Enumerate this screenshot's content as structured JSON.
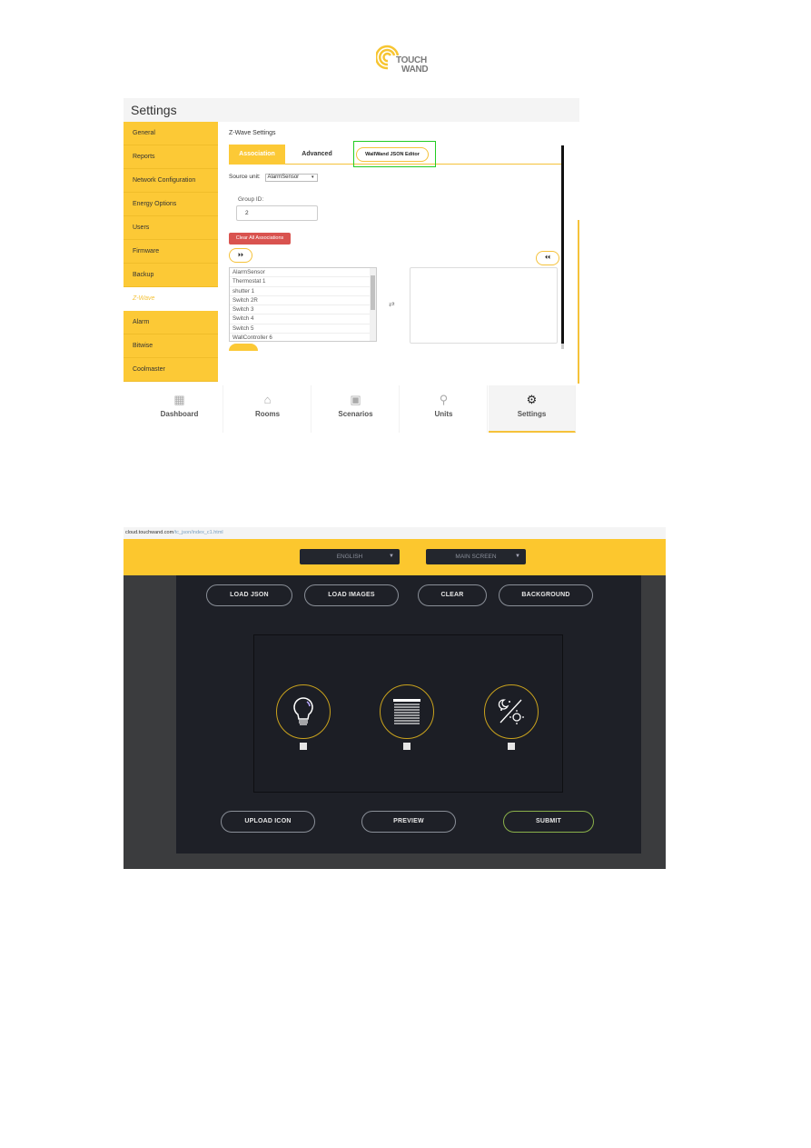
{
  "logo": {
    "line1": "TOUCH",
    "line2": "WAND"
  },
  "settings_screen": {
    "title": "Settings",
    "sidebar": [
      {
        "label": "General",
        "active": false
      },
      {
        "label": "Reports",
        "active": false
      },
      {
        "label": "Network Configuration",
        "active": false
      },
      {
        "label": "Energy Options",
        "active": false
      },
      {
        "label": "Users",
        "active": false
      },
      {
        "label": "Firmware",
        "active": false
      },
      {
        "label": "Backup",
        "active": false
      },
      {
        "label": "Z-Wave",
        "active": true
      },
      {
        "label": "Alarm",
        "active": false
      },
      {
        "label": "Bitwise",
        "active": false
      },
      {
        "label": "Coolmaster",
        "active": false
      }
    ],
    "zwave": {
      "section_title": "Z-Wave Settings",
      "tabs": [
        {
          "label": "Association",
          "active": true
        },
        {
          "label": "Advanced",
          "active": false
        },
        {
          "label": "WallWand JSON Editor",
          "active": false,
          "highlighted": true
        }
      ],
      "source_unit_label": "Source unit:",
      "source_unit_value": "AlarmSensor",
      "group_id_label": "Group ID:",
      "group_id_value": "2",
      "clear_button": "Clear All Associations",
      "move_right_icon": "double-chevron-right",
      "move_left_icon": "double-chevron-left",
      "swap_icon": "swap-arrows",
      "units": [
        "AlarmSensor",
        "Thermostat 1",
        "shutter 1",
        "Switch 2R",
        "Switch 3",
        "Switch 4",
        "Switch 5",
        "WallController 6"
      ],
      "associated_units": []
    },
    "bottom_nav": [
      {
        "label": "Dashboard",
        "icon": "dashboard-icon",
        "active": false
      },
      {
        "label": "Rooms",
        "icon": "rooms-icon",
        "active": false
      },
      {
        "label": "Scenarios",
        "icon": "scenarios-icon",
        "active": false
      },
      {
        "label": "Units",
        "icon": "units-icon",
        "active": false
      },
      {
        "label": "Settings",
        "icon": "gear-icon",
        "active": true
      }
    ]
  },
  "json_editor": {
    "url_domain": "cloud.touchwand.com",
    "url_path": "/tc_json/index_c1.html",
    "language_select": "ENGLISH",
    "screen_select": "MAIN SCREEN",
    "toolbar": {
      "load_json": "LOAD JSON",
      "load_images": "LOAD IMAGES",
      "clear": "CLEAR",
      "background": "BACKGROUND"
    },
    "icons": [
      {
        "name": "light-bulb",
        "checked": false
      },
      {
        "name": "blinds",
        "checked": false
      },
      {
        "name": "day-night",
        "checked": false
      }
    ],
    "footer": {
      "upload_icon": "UPLOAD ICON",
      "preview": "PREVIEW",
      "submit": "SUBMIT"
    }
  },
  "colors": {
    "brand_yellow": "#fcc936",
    "danger_red": "#d9534f",
    "highlight_green": "#22cc22",
    "editor_dark": "#1e2027",
    "submit_green": "#8ab04a"
  }
}
